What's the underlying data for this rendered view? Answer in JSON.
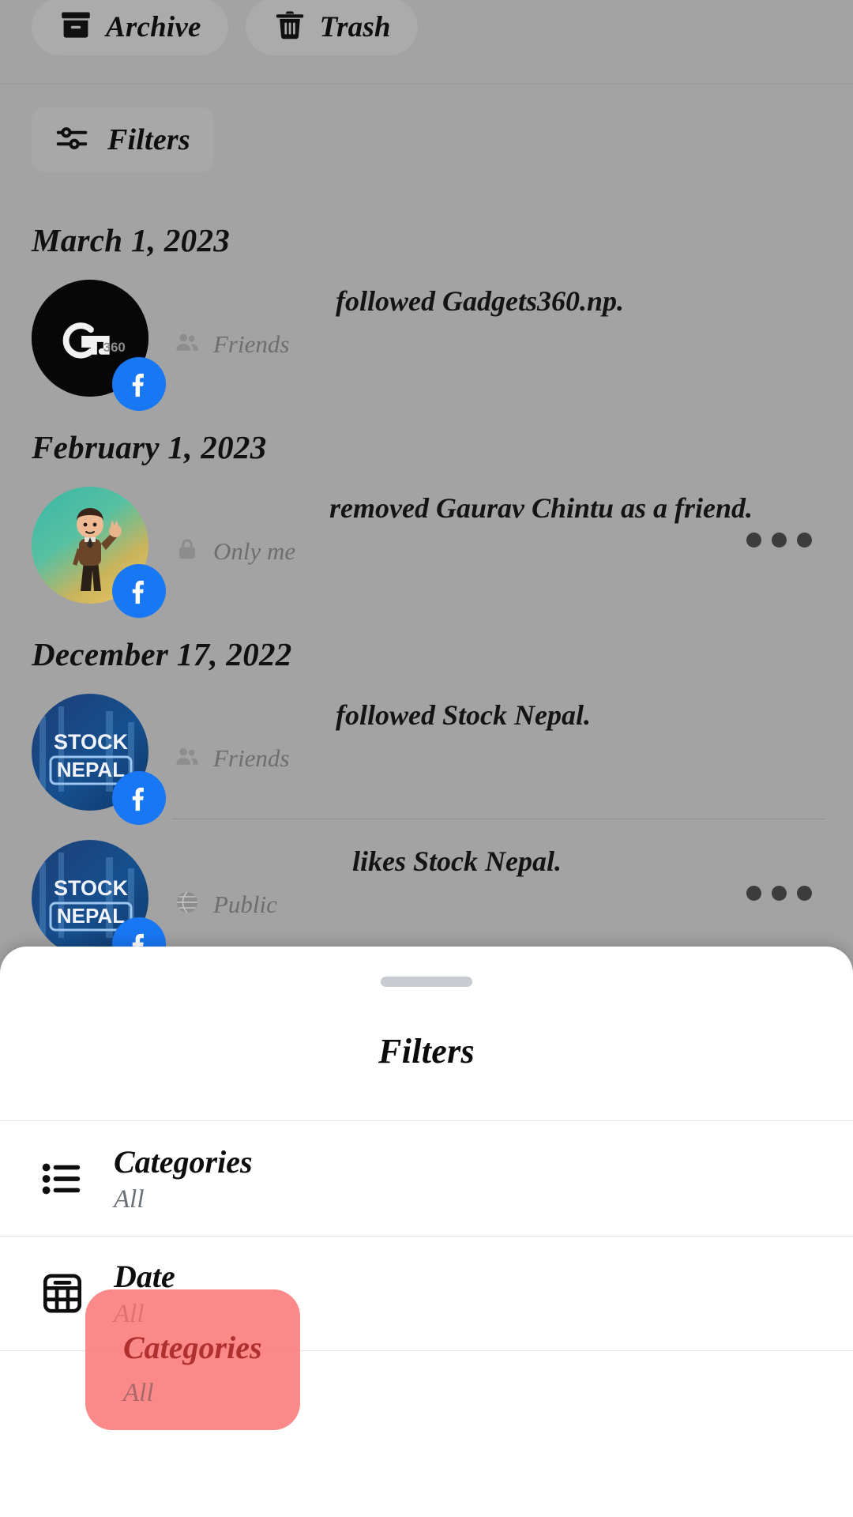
{
  "top_bar": {
    "buttons": [
      {
        "label": "Archive",
        "icon": "archive-icon"
      },
      {
        "label": "Trash",
        "icon": "trash-icon"
      }
    ]
  },
  "filters_bar": {
    "label": "Filters",
    "icon": "sliders-icon"
  },
  "feed": {
    "groups": [
      {
        "date": "March 1, 2023",
        "entries": [
          {
            "avatar": "gadgets360-logo",
            "platform_badge": "facebook-icon",
            "text": "followed Gadgets360.np.",
            "name_redacted": true,
            "privacy": "Friends",
            "privacy_icon": "friends-icon",
            "has_menu": false
          }
        ]
      },
      {
        "date": "February 1, 2023",
        "entries": [
          {
            "avatar": "bitmoji-avatar",
            "platform_badge": "facebook-icon",
            "text": "removed Gaurav Chintu",
            "text_line2": "as a friend.",
            "name_redacted": false,
            "privacy": "Only me",
            "privacy_icon": "lock-icon",
            "has_menu": true,
            "menu_icon": "more-options-icon"
          }
        ]
      },
      {
        "date": "December 17, 2022",
        "entries": [
          {
            "avatar": "stock-nepal-logo",
            "platform_badge": "facebook-icon",
            "text": "followed Stock Nepal.",
            "name_redacted": true,
            "privacy": "Friends",
            "privacy_icon": "friends-icon",
            "has_menu": false
          },
          {
            "avatar": "stock-nepal-logo",
            "platform_badge": "facebook-icon",
            "text": "likes Stock Nepal.",
            "name_redacted": false,
            "privacy": "Public",
            "privacy_icon": "globe-icon",
            "has_menu": true,
            "menu_icon": "more-options-icon"
          }
        ]
      }
    ]
  },
  "filters_sheet": {
    "title": "Filters",
    "rows": [
      {
        "title": "Categories",
        "value": "All",
        "icon": "list-icon",
        "highlighted": true
      },
      {
        "title": "Date",
        "value": "All",
        "icon": "calendar-icon",
        "highlighted": false
      }
    ]
  },
  "colors": {
    "backdrop": "#a3a3a3",
    "sheet_bg": "#ffffff",
    "facebook_blue": "#1877f2",
    "highlight_red": "#fb6f6f",
    "highlight_text": "#b03030"
  }
}
